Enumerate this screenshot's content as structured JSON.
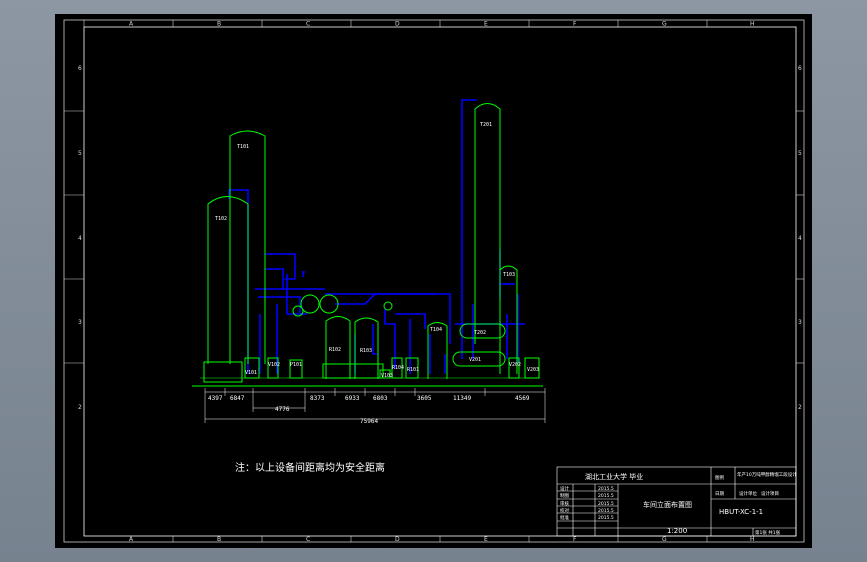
{
  "grid": {
    "columns": [
      "A",
      "B",
      "C",
      "D",
      "E",
      "F",
      "G",
      "H"
    ],
    "rows": [
      "6",
      "5",
      "4",
      "3",
      "2"
    ]
  },
  "equipment_labels": {
    "t101": "T101",
    "t102": "T102",
    "t103": "T103",
    "t104": "T104",
    "t201": "T201",
    "t202": "T202",
    "r102": "R102",
    "r103": "R103",
    "r104": "R104",
    "r101": "R101",
    "v101": "V101",
    "v102": "V102",
    "p101": "P101",
    "v103": "V103",
    "v201": "V201",
    "v202": "V202",
    "v203": "V203"
  },
  "dimensions": {
    "d1": "4397",
    "d2": "6847",
    "d3": "4776",
    "d4": "8373",
    "d5": "6933",
    "d6": "6803",
    "d7": "3605",
    "d8": "11349",
    "d9": "4569",
    "total": "75964"
  },
  "note": "注：以上设备间距离均为安全距离",
  "title_block": {
    "school": "湖北工业大学  毕业",
    "drawing_title": "车间立面布置图",
    "scale": "1:200",
    "drawing_number": "HBUT-XC-1-1",
    "project_desc": "年产10万吨甲醇精馏工段设计",
    "roles": [
      "设计",
      "制图",
      "审核",
      "校对",
      "批准"
    ],
    "names": [
      "",
      "",
      "",
      "",
      ""
    ],
    "dates": [
      "2015.5",
      "2015.5",
      "2015.5",
      "2015.5",
      "2015.5"
    ],
    "sheet_info": "第1张  共1张",
    "cells": [
      "图例",
      "日期",
      "设计单位",
      "设计项目"
    ]
  },
  "colors": {
    "equipment": "#00ff00",
    "pipes": "#0000ff",
    "frame": "#ffffff",
    "background": "#000000"
  }
}
